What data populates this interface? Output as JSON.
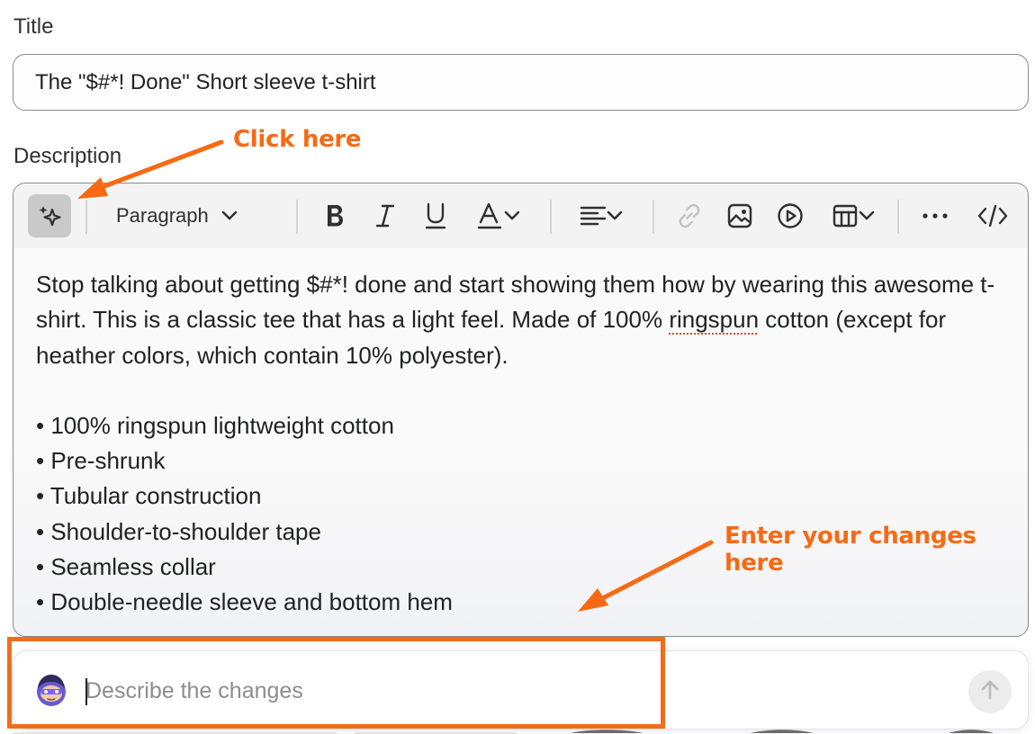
{
  "fields": {
    "title_label": "Title",
    "title_value": "The \"$#*! Done\" Short sleeve t-shirt",
    "description_label": "Description"
  },
  "toolbar": {
    "magic_icon": "sparkles-icon",
    "paragraph_label": "Paragraph",
    "buttons": [
      "bold-icon",
      "italic-icon",
      "underline-icon",
      "text-color-icon",
      "align-icon",
      "link-icon",
      "image-icon",
      "video-icon",
      "table-icon",
      "more-icon",
      "code-icon"
    ]
  },
  "description": {
    "paragraph_before": "Stop talking about getting $#*! done and start showing them how by wearing this awesome t-shirt. This is a classic tee that has a light feel. Made of 100% ",
    "paragraph_misspelled": "ringspun",
    "paragraph_after": " cotton (except for heather colors, which contain 10% polyester).",
    "bullets": [
      "100% ringspun lightweight cotton",
      "Pre-shrunk",
      "Tubular construction",
      "Shoulder-to-shoulder tape",
      "Seamless collar",
      "Double-needle sleeve and bottom hem"
    ]
  },
  "chat": {
    "placeholder": "Describe the changes",
    "avatar_icon": "assistant-avatar-icon",
    "send_icon": "arrow-up-icon"
  },
  "annotations": {
    "click_here": "Click here",
    "enter_changes": "Enter your changes here",
    "color": "#f76a13"
  }
}
